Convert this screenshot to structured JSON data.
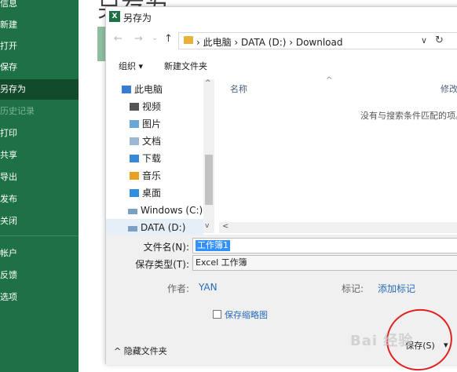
{
  "sidebar": {
    "items": [
      {
        "label": "信息"
      },
      {
        "label": "新建"
      },
      {
        "label": "打开"
      },
      {
        "label": "保存"
      },
      {
        "label": "另存为"
      },
      {
        "label": "历史记录"
      },
      {
        "label": "打印"
      },
      {
        "label": "共享"
      },
      {
        "label": "导出"
      },
      {
        "label": "发布"
      },
      {
        "label": "关闭"
      },
      {
        "label": "帐户"
      },
      {
        "label": "反馈"
      },
      {
        "label": "选项"
      }
    ],
    "active": "另存为",
    "disabled": "历史记录"
  },
  "backstage": {
    "title": "另存为"
  },
  "dialog": {
    "title": "另存为",
    "app_icon": "X",
    "nav": {
      "back": "←",
      "forward": "→",
      "recent": "⌄",
      "up": "↑"
    },
    "address": {
      "path": "› 此电脑 › DATA (D:) › Download",
      "dropdown": "∨",
      "refresh": "↻"
    },
    "toolbar": {
      "organize": "组织 ▾",
      "new_folder": "新建文件夹"
    },
    "navpane": {
      "items": [
        {
          "label": "此电脑",
          "icon": "computer-icon"
        },
        {
          "label": "视频",
          "icon": "video-icon"
        },
        {
          "label": "图片",
          "icon": "picture-icon"
        },
        {
          "label": "文档",
          "icon": "document-icon"
        },
        {
          "label": "下载",
          "icon": "download-icon"
        },
        {
          "label": "音乐",
          "icon": "music-icon"
        },
        {
          "label": "桌面",
          "icon": "desktop-icon"
        },
        {
          "label": "Windows (C:)",
          "icon": "drive-icon"
        },
        {
          "label": "DATA (D:)",
          "icon": "drive-icon"
        }
      ],
      "scroll_up": "^",
      "scroll_down": "v"
    },
    "filelist": {
      "col_name": "名称",
      "col_sort": "^",
      "col_modified": "修改",
      "empty_message": "没有与搜索条件匹配的项。",
      "hscroll_left": "<"
    },
    "form": {
      "filename_label": "文件名(N):",
      "filename_value": "工作簿1",
      "filetype_label": "保存类型(T):",
      "filetype_value": "Excel 工作簿",
      "author_label": "作者:",
      "author_value": "YAN",
      "tags_label": "标记:",
      "tags_value": "添加标记",
      "thumbnail_label": "保存缩略图"
    },
    "footer": {
      "hide_folders": "^ 隐藏文件夹",
      "save_button": "保存(S)",
      "save_dropdown": "▾"
    }
  },
  "watermark": "Bai 经验",
  "colors": {
    "excel_green": "#1e7145",
    "active_green": "#124a2c",
    "link_blue": "#2a6bb8",
    "annotation_red": "#e02020"
  }
}
